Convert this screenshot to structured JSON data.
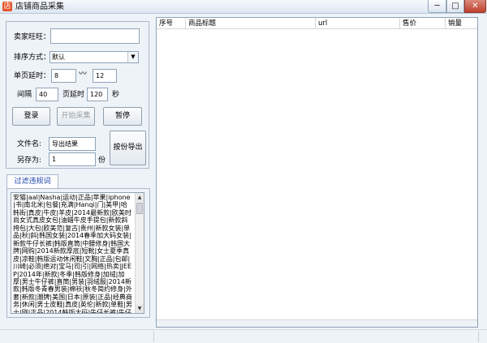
{
  "window": {
    "title": "店铺商品采集",
    "app_icon_glyph": "店",
    "min_glyph": "─",
    "max_glyph": "□",
    "close_glyph": "✕"
  },
  "settings": {
    "seller_label": "卖家旺旺：",
    "seller_value": "",
    "sort_label": "排序方式：",
    "sort_value": "默认",
    "delay_label": "单页延时：",
    "delay_min": "8",
    "delay_sep": "〰",
    "delay_max": "12",
    "interval_label": "间隔",
    "interval_value": "40",
    "page_delay_label": "页延时",
    "page_delay_value": "120",
    "seconds_label": "秒",
    "login_label": "登录",
    "start_label": "开始采集",
    "pause_label": "暂停",
    "filename_label": "文件名:",
    "filename_value": "导出结果",
    "save_as_label": "另存为:",
    "save_as_value": "1",
    "parts_label": "份",
    "export_label": "按份导出"
  },
  "filter": {
    "tab_label": "过滤违规词",
    "text": "安猫|aal|Nasha|运动|正品|苹果|iphone|书|南北米|包餐|充满|Hanqi|门|美甲|哈韩街|真皮|牛皮|羊皮|2014最新款|欧美时尚女式真皮女包|油蜡牛皮手提包|新款斜挎包|大包|欧美范|复古|贵州|新款女装|单品|秋|斜|韩国女装|2014春季加大码女装|新款牛仔长裤|韩版直筒|中腰修身|韩国大牌|网购|2014新款厚底|短靴|女士夏季真皮|凉鞋|韩版运动休闲鞋|文胸|正品|包邮|川崎|必须|绝对|宝马|司|引|网络|热卖|JEEP|2014年|新款|冬季|韩版修身|加绒|加厚|男士牛仔裤|直筒|男装|羽绒服|2014新款|韩版冬青春男装|棉袄|秋冬简约修身|外套|新款|潮牌|美国|日本|原装|正品|经典商务|休闲|男士皮鞋|真皮|英伦|新款|单鞋|男士|刚|正品|2014韩版大码|牛仔长裤|牛仔中|腰牛仔裤|男|直筒|青少年|牛仔裤子|韩版"
  },
  "table": {
    "columns": [
      "序号",
      "商品标题",
      "url",
      "售价",
      "销量"
    ]
  }
}
